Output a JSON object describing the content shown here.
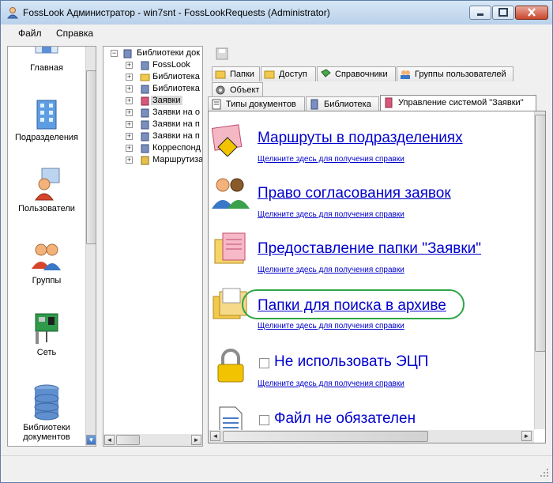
{
  "window": {
    "title": "FossLook Администратор - win7snt - FossLookRequests (Administrator)"
  },
  "menu": {
    "items": [
      "Файл",
      "Справка"
    ]
  },
  "nav": {
    "items": [
      {
        "label": "Главная",
        "icon": "home-icon"
      },
      {
        "label": "Подразделения",
        "icon": "building-icon"
      },
      {
        "label": "Пользователи",
        "icon": "user-icon"
      },
      {
        "label": "Группы",
        "icon": "users-icon"
      },
      {
        "label": "Сеть",
        "icon": "network-card-icon"
      },
      {
        "label": "Библиотеки документов",
        "icon": "database-icon"
      }
    ]
  },
  "tree": {
    "root": "Библиотеки док",
    "items": [
      {
        "label": "FossLook",
        "selected": false
      },
      {
        "label": "Библиотека",
        "selected": false
      },
      {
        "label": "Библиотека",
        "selected": false
      },
      {
        "label": "Заявки",
        "selected": true
      },
      {
        "label": "Заявки на о",
        "selected": false
      },
      {
        "label": "Заявки на п",
        "selected": false
      },
      {
        "label": "Заявки на п",
        "selected": false
      },
      {
        "label": "Корреспонд",
        "selected": false
      },
      {
        "label": "Маршрутиза",
        "selected": false
      }
    ]
  },
  "tabs": {
    "row1": [
      "Папки",
      "Доступ",
      "Справочники",
      "Группы пользователей"
    ],
    "row2": [
      "Объект"
    ],
    "row3": [
      "Типы документов",
      "Библиотека",
      "Управление системой \"Заявки\""
    ],
    "active": "Управление системой \"Заявки\""
  },
  "content": {
    "help_text": "Щелкните здесь для получения справки",
    "entries": [
      {
        "title": "Маршруты в подразделениях",
        "kind": "link",
        "icon": "route-sign-icon"
      },
      {
        "title": "Право согласования заявок",
        "kind": "link",
        "icon": "users-icon"
      },
      {
        "title": "Предоставление папки \"Заявки\"",
        "kind": "link",
        "icon": "folder-documents-icon"
      },
      {
        "title": "Папки для поиска в архиве",
        "kind": "link",
        "icon": "folders-icon"
      },
      {
        "title": "Не использовать ЭЦП",
        "kind": "checkbox",
        "checked": false,
        "icon": "padlock-icon"
      },
      {
        "title": "Файл не обязателен",
        "kind": "checkbox",
        "checked": false,
        "icon": "document-icon"
      }
    ],
    "highlight_color": "#2da645"
  },
  "colors": {
    "link": "#0000cc",
    "titlebar_top": "#d6e6f6",
    "titlebar_bottom": "#b9d1ea"
  }
}
